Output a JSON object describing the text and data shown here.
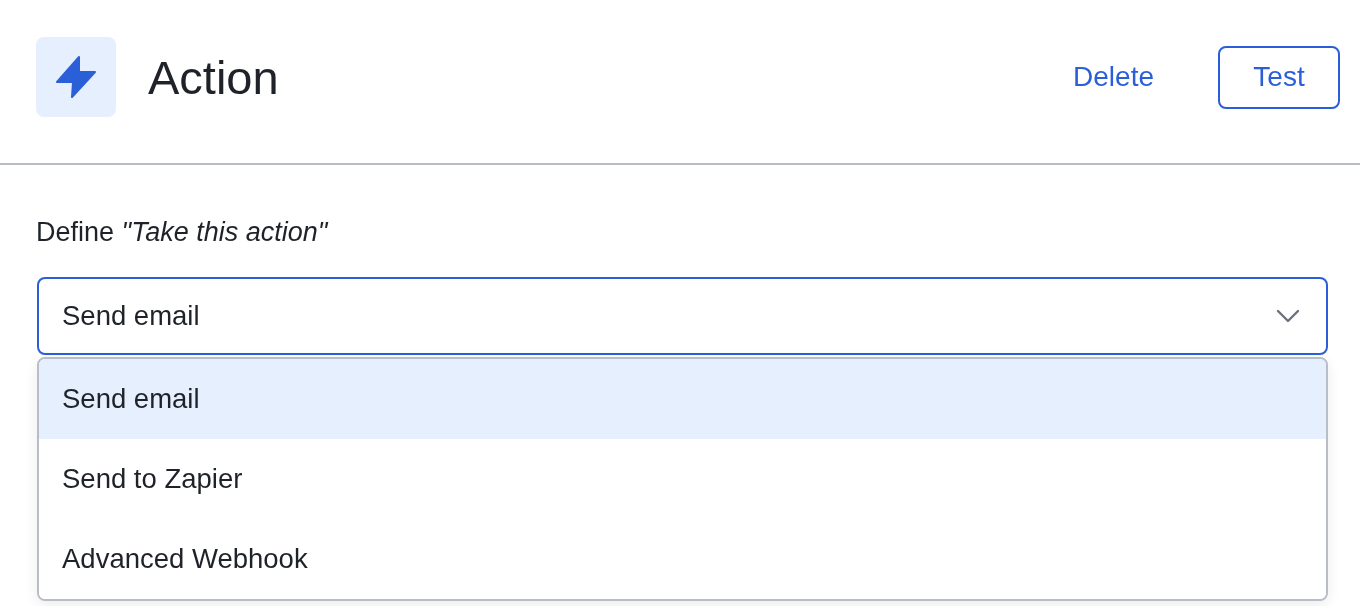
{
  "header": {
    "title": "Action",
    "actions": [
      {
        "label": "Delete",
        "kind": "link"
      },
      {
        "label": "Test",
        "kind": "outline"
      }
    ]
  },
  "field": {
    "label": "Define *\"Take this action\"*",
    "value": "Send email",
    "expanded": true,
    "options": [
      {
        "label": "Send email",
        "selected": true
      },
      {
        "label": "Send to Zapier",
        "selected": false
      },
      {
        "label": "Advanced Webhook",
        "selected": false
      }
    ]
  }
}
